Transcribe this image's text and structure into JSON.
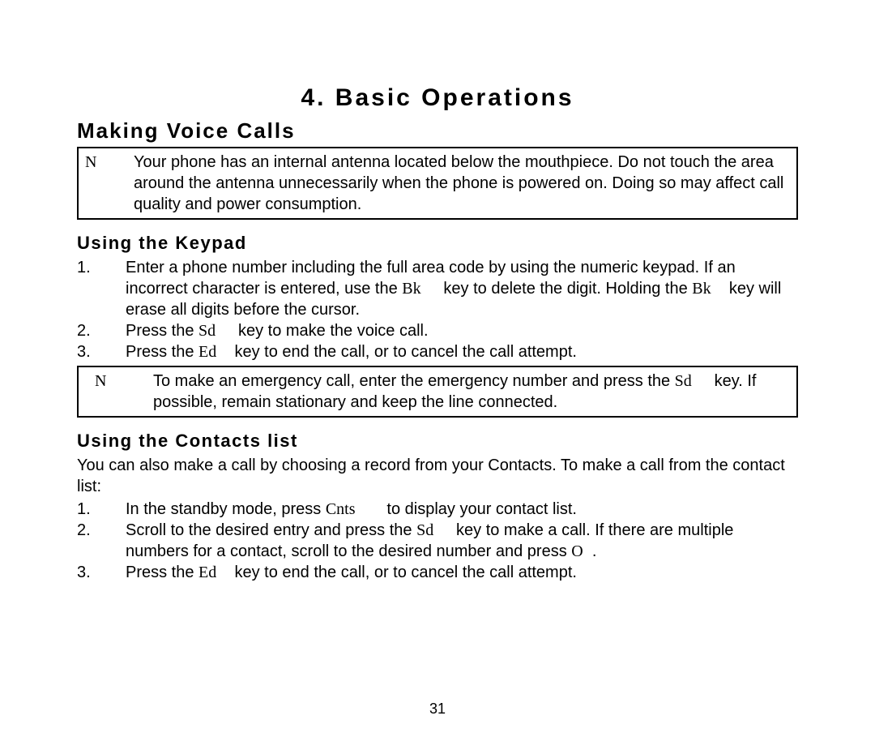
{
  "chapter": {
    "title": "4.  Basic Operations"
  },
  "section": {
    "title": "Making Voice Calls"
  },
  "note1": {
    "marker": "N",
    "text": "Your phone has an internal antenna located below the mouthpiece. Do not touch the area around the antenna unnecessarily when the phone is powered on. Doing so may affect call quality and power consumption."
  },
  "sub1": {
    "title": "Using the Keypad"
  },
  "keypad": {
    "step1_a": "Enter a phone number including the full area code by using the numeric keypad. If an incorrect character is entered, use the ",
    "step1_key1": "Bk",
    "step1_b": " key to delete the digit. Holding the ",
    "step1_key2": "Bk",
    "step1_c": " key will erase all digits before the cursor.",
    "step2_a": "Press the ",
    "step2_key": "Sd",
    "step2_b": " key to make the voice call.",
    "step3_a": "Press the ",
    "step3_key": "Ed",
    "step3_b": " key to end the call, or to cancel the call attempt."
  },
  "note2": {
    "marker": "N",
    "text_a": "To make an emergency call, enter the emergency number and press the ",
    "key": "Sd",
    "text_b": " key. If possible, remain stationary and keep the line connected."
  },
  "sub2": {
    "title": "Using the Contacts list"
  },
  "contacts_intro": "You can also make a call by choosing a record from your Contacts. To make a call from the contact list:",
  "contacts": {
    "step1_a": "In the standby mode, press ",
    "step1_key": "Cnts",
    "step1_b": " to display your contact list.",
    "step2_a": "Scroll to the desired entry and press the ",
    "step2_key1": "Sd",
    "step2_b": " key to make a call. If there are multiple numbers for a contact, scroll to the desired number and press ",
    "step2_key2": "O",
    "step2_c": ".",
    "step3_a": "Press the ",
    "step3_key": "Ed",
    "step3_b": " key to end the call, or to cancel the call attempt."
  },
  "page_number": "31"
}
